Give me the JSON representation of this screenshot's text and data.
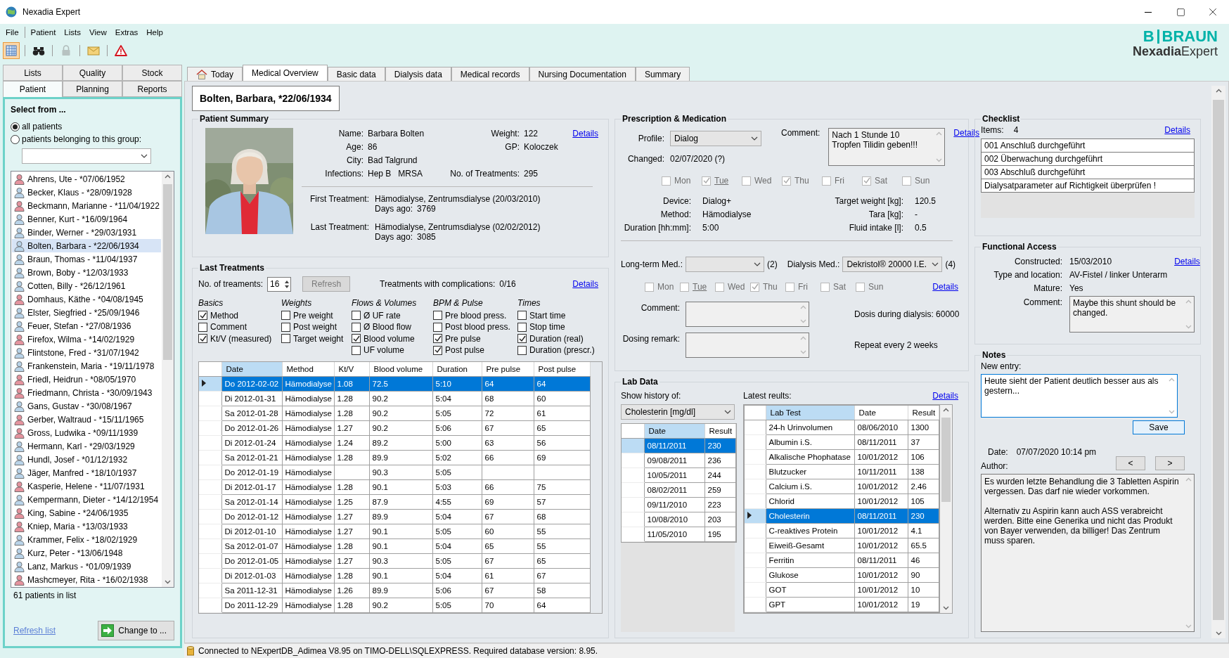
{
  "window": {
    "title": "Nexadia Expert"
  },
  "menu": [
    "File",
    "Patient",
    "Lists",
    "View",
    "Extras",
    "Help"
  ],
  "toolbar": [
    {
      "kind": "grid",
      "pressed": true,
      "disabled": false
    },
    {
      "kind": "binoculars",
      "pressed": false,
      "disabled": false
    },
    {
      "kind": "lock",
      "pressed": false,
      "disabled": true
    },
    {
      "kind": "envelope",
      "pressed": false,
      "disabled": false
    },
    {
      "kind": "warning",
      "pressed": false,
      "disabled": false
    }
  ],
  "logo": {
    "mark": "B",
    "brand": "BRAUN",
    "product": "**Nexadia**Expert"
  },
  "side_tabs": [
    {
      "label": "Lists",
      "selected": false
    },
    {
      "label": "Quality",
      "selected": false
    },
    {
      "label": "Stock",
      "selected": false
    },
    {
      "label": "Patient",
      "selected": true
    },
    {
      "label": "Planning",
      "selected": false
    },
    {
      "label": "Reports",
      "selected": false
    }
  ],
  "patient_select": {
    "title": "Select from ...",
    "options": [
      {
        "label": "all patients",
        "selected": true
      },
      {
        "label": "patients belonging to this group:",
        "selected": false
      }
    ],
    "patients": [
      {
        "name": "Ahrens, Ute - *07/06/1952",
        "color": "#e4939e",
        "selected": false
      },
      {
        "name": "Becker, Klaus - *28/09/1928",
        "color": "#b9d3e8",
        "selected": false
      },
      {
        "name": "Beckmann, Marianne - *11/04/1922",
        "color": "#e4939e",
        "selected": false
      },
      {
        "name": "Benner, Kurt - *16/09/1964",
        "color": "#b9d3e8",
        "selected": false
      },
      {
        "name": "Binder, Werner - *29/03/1931",
        "color": "#b9d3e8",
        "selected": false
      },
      {
        "name": "Bolten, Barbara - *22/06/1934",
        "color": "#b9d3e8",
        "selected": true
      },
      {
        "name": "Braun, Thomas - *11/04/1937",
        "color": "#b9d3e8",
        "selected": false
      },
      {
        "name": "Brown, Boby - *12/03/1933",
        "color": "#b9d3e8",
        "selected": false
      },
      {
        "name": "Cotten, Billy - *26/12/1961",
        "color": "#b9d3e8",
        "selected": false
      },
      {
        "name": "Domhaus, Käthe - *04/08/1945",
        "color": "#e4939e",
        "selected": false
      },
      {
        "name": "Elster, Siegfried - *25/09/1946",
        "color": "#b9d3e8",
        "selected": false
      },
      {
        "name": "Feuer, Stefan - *27/08/1936",
        "color": "#b9d3e8",
        "selected": false
      },
      {
        "name": "Firefox, Wilma - *14/02/1929",
        "color": "#e4939e",
        "selected": false
      },
      {
        "name": "Flintstone, Fred - *31/07/1942",
        "color": "#b9d3e8",
        "selected": false
      },
      {
        "name": "Frankenstein, Maria - *19/11/1978",
        "color": "#b9d3e8",
        "selected": false
      },
      {
        "name": "Friedl, Heidrun - *08/05/1970",
        "color": "#e4939e",
        "selected": false
      },
      {
        "name": "Friedmann, Christa - *30/09/1943",
        "color": "#e4939e",
        "selected": false
      },
      {
        "name": "Gans, Gustav - *30/08/1967",
        "color": "#b9d3e8",
        "selected": false
      },
      {
        "name": "Gerber, Waltraud - *15/11/1965",
        "color": "#e4939e",
        "selected": false
      },
      {
        "name": "Gross, Ludwika - *09/11/1939",
        "color": "#e4939e",
        "selected": false
      },
      {
        "name": "Hermann, Karl - *29/03/1929",
        "color": "#b9d3e8",
        "selected": false
      },
      {
        "name": "Hundl, Josef - *01/12/1932",
        "color": "#b9d3e8",
        "selected": false
      },
      {
        "name": "Jäger, Manfred - *18/10/1937",
        "color": "#b9d3e8",
        "selected": false
      },
      {
        "name": "Kasperie, Helene - *11/07/1931",
        "color": "#e4939e",
        "selected": false
      },
      {
        "name": "Kempermann, Dieter - *14/12/1954",
        "color": "#b9d3e8",
        "selected": false
      },
      {
        "name": "King, Sabine - *24/06/1935",
        "color": "#e4939e",
        "selected": false
      },
      {
        "name": "Kniep, Maria - *13/03/1933",
        "color": "#e4939e",
        "selected": false
      },
      {
        "name": "Krammer, Felix - *18/02/1929",
        "color": "#b9d3e8",
        "selected": false
      },
      {
        "name": "Kurz, Peter - *13/06/1948",
        "color": "#b9d3e8",
        "selected": false
      },
      {
        "name": "Lanz, Markus - *01/09/1939",
        "color": "#b9d3e8",
        "selected": false
      },
      {
        "name": "Mashcmeyer, Rita - *16/02/1938",
        "color": "#e4939e",
        "selected": false
      }
    ],
    "count": "61 patients in list",
    "refresh": "Refresh list",
    "change_button": "Change to ..."
  },
  "tabs": [
    {
      "label": "Today",
      "kind": "home",
      "selected": false
    },
    {
      "label": "Medical Overview",
      "kind": "text",
      "selected": true
    },
    {
      "label": "Basic data",
      "kind": "text",
      "selected": false
    },
    {
      "label": "Dialysis data",
      "kind": "text",
      "selected": false
    },
    {
      "label": "Medical records",
      "kind": "text",
      "selected": false
    },
    {
      "label": "Nursing Documentation",
      "kind": "text",
      "selected": false
    },
    {
      "label": "Summary",
      "kind": "text",
      "selected": false
    }
  ],
  "patient_header": "Bolten, Barbara, *22/06/1934",
  "patient_summary": {
    "title": "Patient Summary",
    "fields_left": [
      {
        "label": "Name:",
        "values": [
          "Barbara Bolten"
        ]
      },
      {
        "label": "Age:",
        "values": [
          "86"
        ]
      },
      {
        "label": "City:",
        "values": [
          "Bad Talgrund"
        ]
      },
      {
        "label": "Infections:",
        "values": [
          "Hep B",
          "MRSA"
        ]
      }
    ],
    "fields_right": [
      {
        "label": "Weight:",
        "value": "122"
      },
      {
        "label": "GP:",
        "value": "Koloczek"
      },
      {
        "label": "No. of Treatments:",
        "value": "295"
      }
    ],
    "details": "Details",
    "treatments": [
      {
        "label": "First Treatment:",
        "value": "Hämodialyse, Zentrumsdialyse (20/03/2010)",
        "days_label": "Days ago:",
        "days": "3769"
      },
      {
        "label": "Last Treatment:",
        "value": "Hämodialyse, Zentrumsdialyse (02/02/2012)",
        "days_label": "Days ago:",
        "days": "3085"
      }
    ]
  },
  "last_treatments": {
    "title": "Last Treatments",
    "count_label": "No. of treaments:",
    "count": "16",
    "refresh": {
      "label": "Refresh",
      "disabled": true
    },
    "complications_label": "Treatments with complications:",
    "complications": "0/16",
    "details": "Details",
    "groups": [
      {
        "title": "Basics",
        "options": [
          {
            "label": "Method",
            "checked": true
          },
          {
            "label": "Comment",
            "checked": false
          },
          {
            "label": "Kt/V (measured)",
            "checked": true
          }
        ]
      },
      {
        "title": "Weights",
        "options": [
          {
            "label": "Pre weight",
            "checked": false
          },
          {
            "label": "Post weight",
            "checked": false
          },
          {
            "label": "Target weight",
            "checked": false
          }
        ]
      },
      {
        "title": "Flows & Volumes",
        "options": [
          {
            "label": "Ø UF rate",
            "checked": false
          },
          {
            "label": "Ø Blood flow",
            "checked": false
          },
          {
            "label": "Blood volume",
            "checked": true
          },
          {
            "label": "UF volume",
            "checked": false
          }
        ]
      },
      {
        "title": "BPM & Pulse",
        "options": [
          {
            "label": "Pre blood press.",
            "checked": false
          },
          {
            "label": "Post blood press.",
            "checked": false
          },
          {
            "label": "Pre pulse",
            "checked": true
          },
          {
            "label": "Post pulse",
            "checked": true
          }
        ]
      },
      {
        "title": "Times",
        "options": [
          {
            "label": "Start time",
            "checked": false
          },
          {
            "label": "Stop time",
            "checked": false
          },
          {
            "label": "Duration (real)",
            "checked": true
          },
          {
            "label": "Duration (prescr.)",
            "checked": false
          }
        ]
      }
    ],
    "table": {
      "columns": [
        {
          "label": "Date",
          "sorted": true
        },
        {
          "label": "Method",
          "sorted": false
        },
        {
          "label": "Kt/V",
          "sorted": false
        },
        {
          "label": "Blood volume",
          "sorted": false
        },
        {
          "label": "Duration",
          "sorted": false
        },
        {
          "label": "Pre pulse",
          "sorted": false
        },
        {
          "label": "Post pulse",
          "sorted": false
        }
      ],
      "rows": [
        {
          "cells": [
            "Do 2012-02-02",
            "Hämodialyse",
            "1.08",
            "72.5",
            "5:10",
            "64",
            "64"
          ],
          "selected": true,
          "current": true
        },
        {
          "cells": [
            "Di 2012-01-31",
            "Hämodialyse",
            "1.28",
            "90.2",
            "5:04",
            "68",
            "60"
          ],
          "selected": false,
          "current": false
        },
        {
          "cells": [
            "Sa 2012-01-28",
            "Hämodialyse",
            "1.28",
            "90.2",
            "5:05",
            "72",
            "61"
          ],
          "selected": false,
          "current": false
        },
        {
          "cells": [
            "Do 2012-01-26",
            "Hämodialyse",
            "1.27",
            "90.2",
            "5:06",
            "67",
            "65"
          ],
          "selected": false,
          "current": false
        },
        {
          "cells": [
            "Di 2012-01-24",
            "Hämodialyse",
            "1.24",
            "89.2",
            "5:00",
            "63",
            "56"
          ],
          "selected": false,
          "current": false
        },
        {
          "cells": [
            "Sa 2012-01-21",
            "Hämodialyse",
            "1.28",
            "89.9",
            "5:02",
            "66",
            "69"
          ],
          "selected": false,
          "current": false
        },
        {
          "cells": [
            "Do 2012-01-19",
            "Hämodialyse",
            "",
            "90.3",
            "5:05",
            "",
            ""
          ],
          "selected": false,
          "current": false
        },
        {
          "cells": [
            "Di 2012-01-17",
            "Hämodialyse",
            "1.28",
            "90.1",
            "5:03",
            "66",
            "75"
          ],
          "selected": false,
          "current": false
        },
        {
          "cells": [
            "Sa 2012-01-14",
            "Hämodialyse",
            "1.25",
            "87.9",
            "4:55",
            "69",
            "57"
          ],
          "selected": false,
          "current": false
        },
        {
          "cells": [
            "Do 2012-01-12",
            "Hämodialyse",
            "1.27",
            "89.9",
            "5:04",
            "67",
            "68"
          ],
          "selected": false,
          "current": false
        },
        {
          "cells": [
            "Di 2012-01-10",
            "Hämodialyse",
            "1.27",
            "90.1",
            "5:05",
            "60",
            "55"
          ],
          "selected": false,
          "current": false
        },
        {
          "cells": [
            "Sa 2012-01-07",
            "Hämodialyse",
            "1.28",
            "90.1",
            "5:04",
            "65",
            "55"
          ],
          "selected": false,
          "current": false
        },
        {
          "cells": [
            "Do 2012-01-05",
            "Hämodialyse",
            "1.27",
            "90.3",
            "5:05",
            "67",
            "65"
          ],
          "selected": false,
          "current": false
        },
        {
          "cells": [
            "Di 2012-01-03",
            "Hämodialyse",
            "1.28",
            "90.1",
            "5:04",
            "61",
            "67"
          ],
          "selected": false,
          "current": false
        },
        {
          "cells": [
            "Sa 2011-12-31",
            "Hämodialyse",
            "1.26",
            "89.9",
            "5:06",
            "67",
            "58"
          ],
          "selected": false,
          "current": false
        },
        {
          "cells": [
            "Do 2011-12-29",
            "Hämodialyse",
            "1.28",
            "90.2",
            "5:05",
            "70",
            "64"
          ],
          "selected": false,
          "current": false
        }
      ]
    }
  },
  "prescription": {
    "title": "Prescription & Medication",
    "profile_label": "Profile:",
    "profile": "Dialog",
    "changed_label": "Changed:",
    "changed": "02/07/2020 (?)",
    "comment_label": "Comment:",
    "comment": "Nach 1 Stunde 10 Tropfen Tilidin geben!!!",
    "details": "Details",
    "days": [
      {
        "label": "Mon",
        "checked": false,
        "today": false
      },
      {
        "label": "Tue",
        "checked": true,
        "today": true
      },
      {
        "label": "Wed",
        "checked": false,
        "today": false
      },
      {
        "label": "Thu",
        "checked": true,
        "today": false
      },
      {
        "label": "Fri",
        "checked": false,
        "today": false
      },
      {
        "label": "Sat",
        "checked": true,
        "today": false
      },
      {
        "label": "Sun",
        "checked": false,
        "today": false
      }
    ],
    "fields_left": [
      {
        "label": "Device:",
        "value": "Dialog+"
      },
      {
        "label": "Method:",
        "value": "Hämodialyse"
      },
      {
        "label": "Duration [hh:mm]:",
        "value": "5:00"
      }
    ],
    "fields_right": [
      {
        "label": "Target weight [kg]:",
        "value": "120.5"
      },
      {
        "label": "Tara [kg]:",
        "value": "-"
      },
      {
        "label": "Fluid intake [l]:",
        "value": "0.5"
      }
    ],
    "long_term_label": "Long-term Med.:",
    "long_term_count": "(2)",
    "dialysis_label": "Dialysis Med.:",
    "dialysis_med": "Dekristol® 20000 I.E.",
    "dialysis_count": "(4)",
    "med_days": [
      {
        "label": "Mon",
        "checked": false,
        "today": false
      },
      {
        "label": "Tue",
        "checked": false,
        "today": true
      },
      {
        "label": "Wed",
        "checked": false,
        "today": false
      },
      {
        "label": "Thu",
        "checked": true,
        "today": false
      },
      {
        "label": "Fri",
        "checked": false,
        "today": false
      },
      {
        "label": "Sat",
        "checked": false,
        "today": false
      },
      {
        "label": "Sun",
        "checked": false,
        "today": false
      }
    ],
    "med_details": "Details",
    "med_comment_label": "Comment:",
    "dosing_label": "Dosing remark:",
    "dose": "Dosis during dialysis: 60000",
    "repeat": "Repeat every 2 weeks"
  },
  "lab_data": {
    "title": "Lab Data",
    "history_label": "Show history of:",
    "history_select": "Cholesterin [mg/dl]",
    "latest_label": "Latest reults:",
    "details": "Details",
    "history": {
      "columns": [
        {
          "label": "Date",
          "sorted": true
        },
        {
          "label": "Result",
          "sorted": false
        }
      ],
      "rows": [
        {
          "cells": [
            "08/11/2011",
            "230"
          ],
          "selected": true
        },
        {
          "cells": [
            "09/08/2011",
            "236"
          ],
          "selected": false
        },
        {
          "cells": [
            "10/05/2011",
            "244"
          ],
          "selected": false
        },
        {
          "cells": [
            "08/02/2011",
            "259"
          ],
          "selected": false
        },
        {
          "cells": [
            "09/11/2010",
            "223"
          ],
          "selected": false
        },
        {
          "cells": [
            "10/08/2010",
            "203"
          ],
          "selected": false
        },
        {
          "cells": [
            "11/05/2010",
            "195"
          ],
          "selected": false
        }
      ]
    },
    "latest": {
      "columns": [
        {
          "label": "Lab Test",
          "sorted": true
        },
        {
          "label": "Date",
          "sorted": false
        },
        {
          "label": "Result",
          "sorted": false
        }
      ],
      "rows": [
        {
          "cells": [
            "24-h Urinvolumen",
            "08/06/2010",
            "1300"
          ],
          "selected": false,
          "current": false
        },
        {
          "cells": [
            "Albumin i.S.",
            "08/11/2011",
            "37"
          ],
          "selected": false,
          "current": false
        },
        {
          "cells": [
            "Alkalische Phophatase",
            "10/01/2012",
            "106"
          ],
          "selected": false,
          "current": false
        },
        {
          "cells": [
            "Blutzucker",
            "10/11/2011",
            "138"
          ],
          "selected": false,
          "current": false
        },
        {
          "cells": [
            "Calcium i.S.",
            "10/01/2012",
            "2.46"
          ],
          "selected": false,
          "current": false
        },
        {
          "cells": [
            "Chlorid",
            "10/01/2012",
            "105"
          ],
          "selected": false,
          "current": false
        },
        {
          "cells": [
            "Cholesterin",
            "08/11/2011",
            "230"
          ],
          "selected": true,
          "current": true
        },
        {
          "cells": [
            "C-reaktives Protein",
            "10/01/2012",
            "4.1"
          ],
          "selected": false,
          "current": false
        },
        {
          "cells": [
            "Eiweiß-Gesamt",
            "10/01/2012",
            "65.5"
          ],
          "selected": false,
          "current": false
        },
        {
          "cells": [
            "Ferritin",
            "08/11/2011",
            "46"
          ],
          "selected": false,
          "current": false
        },
        {
          "cells": [
            "Glukose",
            "10/01/2012",
            "90"
          ],
          "selected": false,
          "current": false
        },
        {
          "cells": [
            "GOT",
            "10/01/2012",
            "10"
          ],
          "selected": false,
          "current": false
        },
        {
          "cells": [
            "GPT",
            "10/01/2012",
            "19"
          ],
          "selected": false,
          "current": false
        }
      ]
    }
  },
  "checklist": {
    "title": "Checklist",
    "items_label": "Items:",
    "items_count": "4",
    "details": "Details",
    "items": [
      "001 Anschluß durchgeführt",
      "002 Überwachung durchgeführt",
      "003 Abschluß durchgeführt",
      "Dialysatparameter auf Richtigkeit überprüfen !"
    ]
  },
  "functional_access": {
    "title": "Functional Access",
    "details": "Details",
    "fields": [
      {
        "label": "Constructed:",
        "value": "15/03/2010"
      },
      {
        "label": "Type and location:",
        "value": "AV-Fistel / linker Unterarm"
      },
      {
        "label": "Mature:",
        "value": "Yes"
      }
    ],
    "comment_label": "Comment:",
    "comment": "Maybe this shunt should be changed."
  },
  "notes": {
    "title": "Notes",
    "new_entry_label": "New entry:",
    "new_entry": "Heute sieht der Patient deutlich besser aus als gestern...",
    "save": "Save",
    "date_label": "Date:",
    "date": "07/07/2020 10:14 pm",
    "author_label": "Author:",
    "prev": "<",
    "next": ">",
    "note": [
      "Es wurden letzte Behandlung die 3 Tabletten Aspirin vergessen. Das darf nie wieder vorkommen.",
      "Alternativ zu Aspirin kann auch ASS verabreicht werden. Bitte eine Generika und nicht das Produkt von Bayer verwenden, da billiger! Das Zentrum muss sparen."
    ]
  },
  "status": "Connected to NExpertDB_Adimea V8.95 on TIMO-DELL\\SQLEXPRESS. Required database version: 8.95."
}
